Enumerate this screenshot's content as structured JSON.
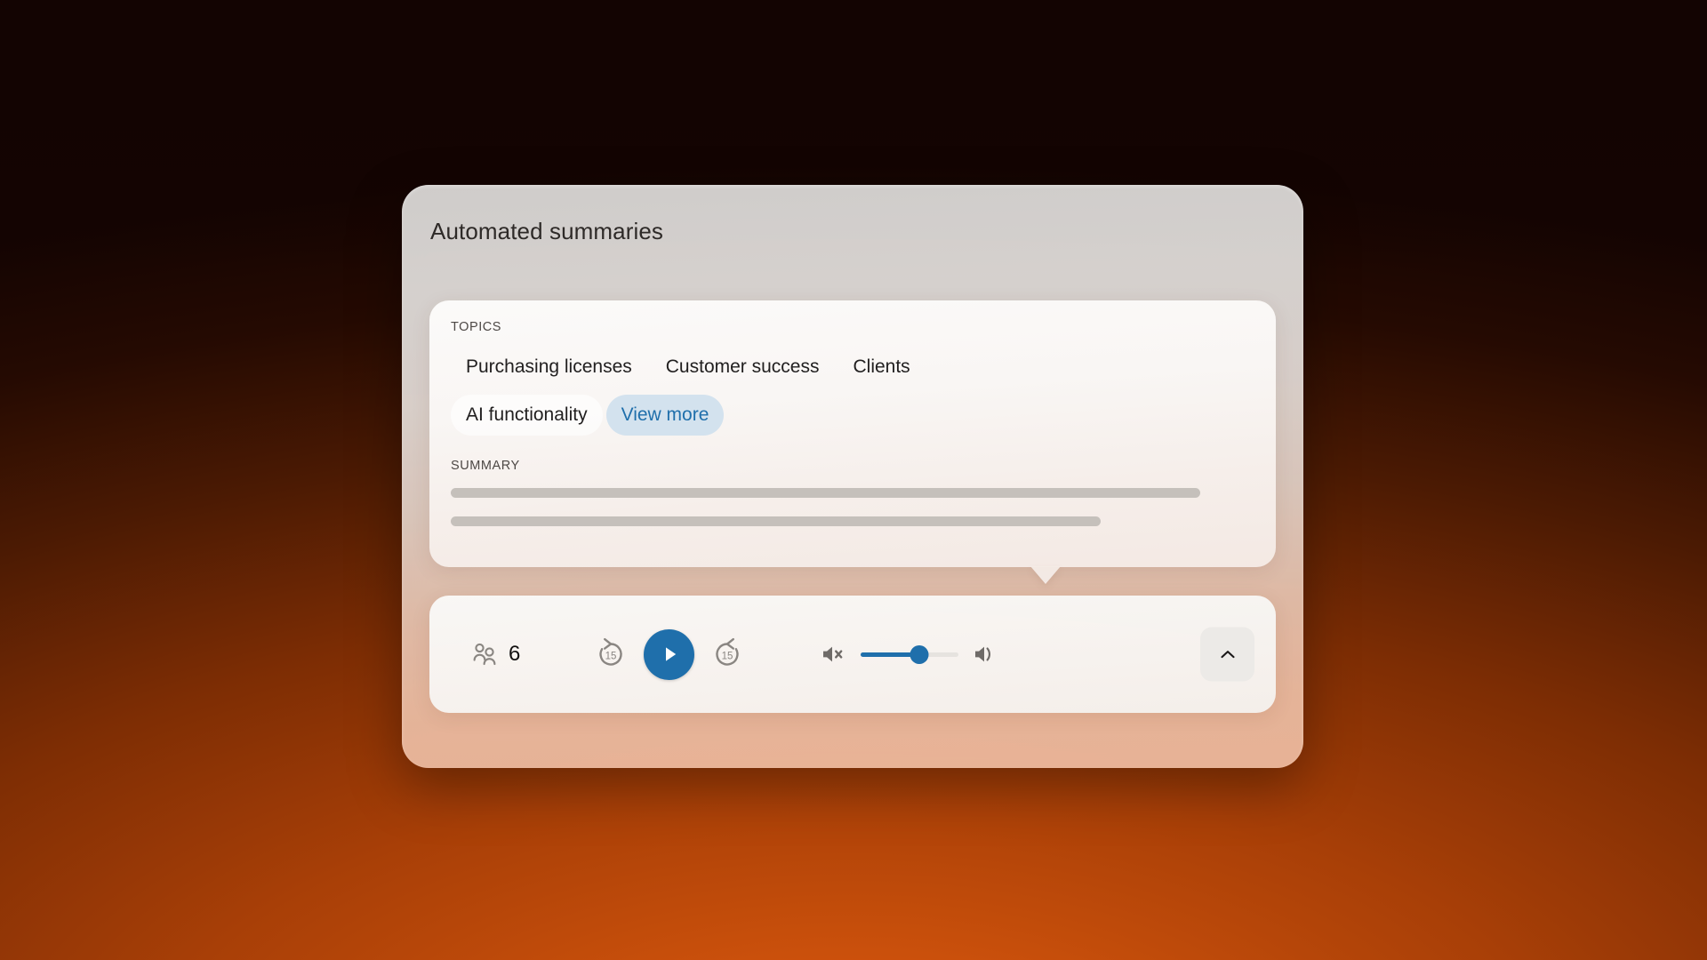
{
  "card": {
    "title": "Automated summaries"
  },
  "topics": {
    "label": "TOPICS",
    "chips": [
      {
        "label": "Purchasing licenses",
        "style": "plain",
        "name": "topic-chip-purchasing-licenses"
      },
      {
        "label": "Customer success",
        "style": "plain",
        "name": "topic-chip-customer-success"
      },
      {
        "label": "Clients",
        "style": "plain",
        "name": "topic-chip-clients"
      },
      {
        "label": "AI functionality",
        "style": "solid",
        "name": "topic-chip-ai-functionality"
      },
      {
        "label": "View more",
        "style": "accent",
        "name": "topic-chip-view-more"
      }
    ]
  },
  "summary": {
    "label": "SUMMARY",
    "placeholder_lines": 2
  },
  "player": {
    "listeners_icon": "people-icon",
    "listeners_count": "6",
    "rewind_label": "15",
    "rewind_icon": "rewind-15-icon",
    "play_icon": "play-icon",
    "forward_label": "15",
    "forward_icon": "forward-15-icon",
    "mute_icon": "volume-mute-icon",
    "volume_up_icon": "volume-up-icon",
    "volume_percent": "60",
    "collapse_icon": "chevron-up-icon"
  },
  "colors": {
    "accent_blue": "#1f6fab",
    "accent_chip_bg": "#d3e2ee",
    "background_top": "#140402",
    "background_bottom": "#c2500b",
    "skeleton": "#c5c0bb"
  }
}
